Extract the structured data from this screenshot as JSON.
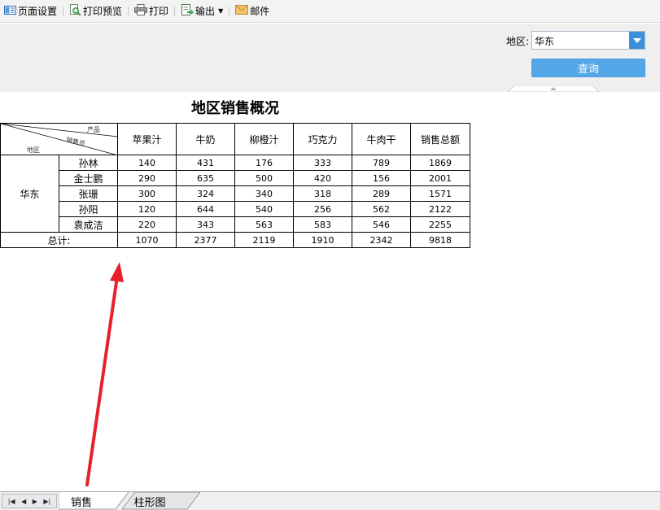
{
  "toolbar": {
    "page_setup": "页面设置",
    "print_preview": "打印预览",
    "print": "打印",
    "export": "输出",
    "mail": "邮件"
  },
  "params": {
    "region_label": "地区:",
    "region_value": "华东",
    "query_label": "查询"
  },
  "report": {
    "title": "地区销售概况",
    "diag_product": "产品",
    "diag_sales": "销售员",
    "diag_region": "地区",
    "columns": [
      "苹果汁",
      "牛奶",
      "柳橙汁",
      "巧克力",
      "牛肉干",
      "销售总额"
    ],
    "region": "华东",
    "rows": [
      {
        "name": "孙林",
        "values": [
          "140",
          "431",
          "176",
          "333",
          "789",
          "1869"
        ]
      },
      {
        "name": "金士鹏",
        "values": [
          "290",
          "635",
          "500",
          "420",
          "156",
          "2001"
        ]
      },
      {
        "name": "张珊",
        "values": [
          "300",
          "324",
          "340",
          "318",
          "289",
          "1571"
        ]
      },
      {
        "name": "孙阳",
        "values": [
          "120",
          "644",
          "540",
          "256",
          "562",
          "2122"
        ]
      },
      {
        "name": "袁成洁",
        "values": [
          "220",
          "343",
          "563",
          "583",
          "546",
          "2255"
        ]
      }
    ],
    "total_label": "总计:",
    "totals": [
      "1070",
      "2377",
      "2119",
      "1910",
      "2342",
      "9818"
    ]
  },
  "sheets": {
    "active": "销售",
    "other": "柱形图"
  },
  "colors": {
    "accent": "#55a8e8",
    "arrow": "#e8202a"
  }
}
